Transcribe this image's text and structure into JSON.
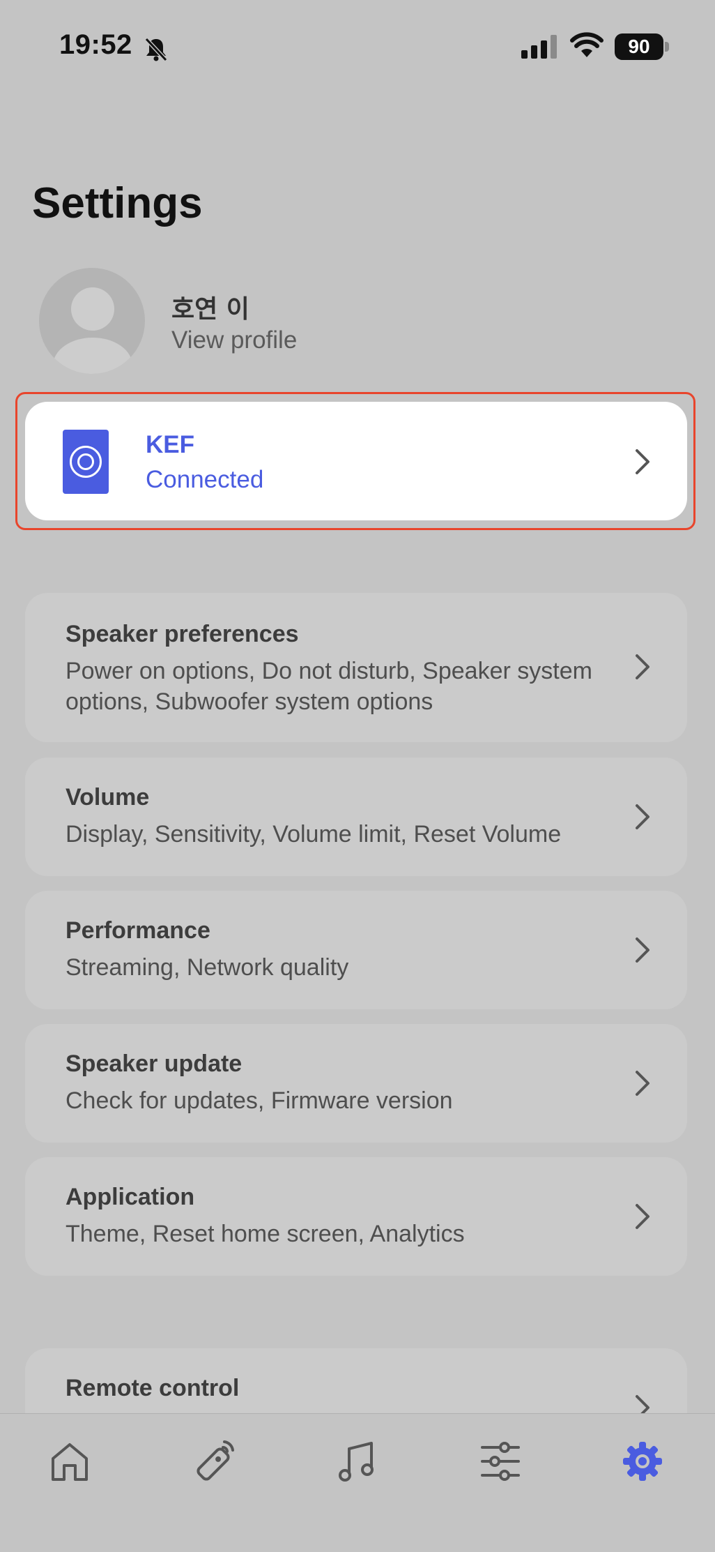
{
  "status_bar": {
    "time": "19:52",
    "battery": "90"
  },
  "page": {
    "title": "Settings"
  },
  "profile": {
    "name": "호연 이",
    "link": "View profile"
  },
  "speaker": {
    "name": "KEF",
    "status": "Connected"
  },
  "settings": [
    {
      "title": "Speaker preferences",
      "description": "Power on options, Do not disturb, Speaker system options, Subwoofer system options"
    },
    {
      "title": "Volume",
      "description": "Display, Sensitivity, Volume limit, Reset Volume"
    },
    {
      "title": "Performance",
      "description": "Streaming, Network quality"
    },
    {
      "title": "Speaker update",
      "description": "Check for updates, Firmware version"
    },
    {
      "title": "Application",
      "description": "Theme, Reset home screen, Analytics"
    },
    {
      "title": "Remote control",
      "description": ""
    }
  ],
  "nav": [
    {
      "icon": "home-icon",
      "active": false
    },
    {
      "icon": "remote-icon",
      "active": false
    },
    {
      "icon": "music-icon",
      "active": false
    },
    {
      "icon": "equalizer-icon",
      "active": false
    },
    {
      "icon": "gear-icon",
      "active": true
    }
  ],
  "colors": {
    "accent": "#4a5ce0",
    "highlight": "#e8452c",
    "background": "#c4c4c4"
  }
}
